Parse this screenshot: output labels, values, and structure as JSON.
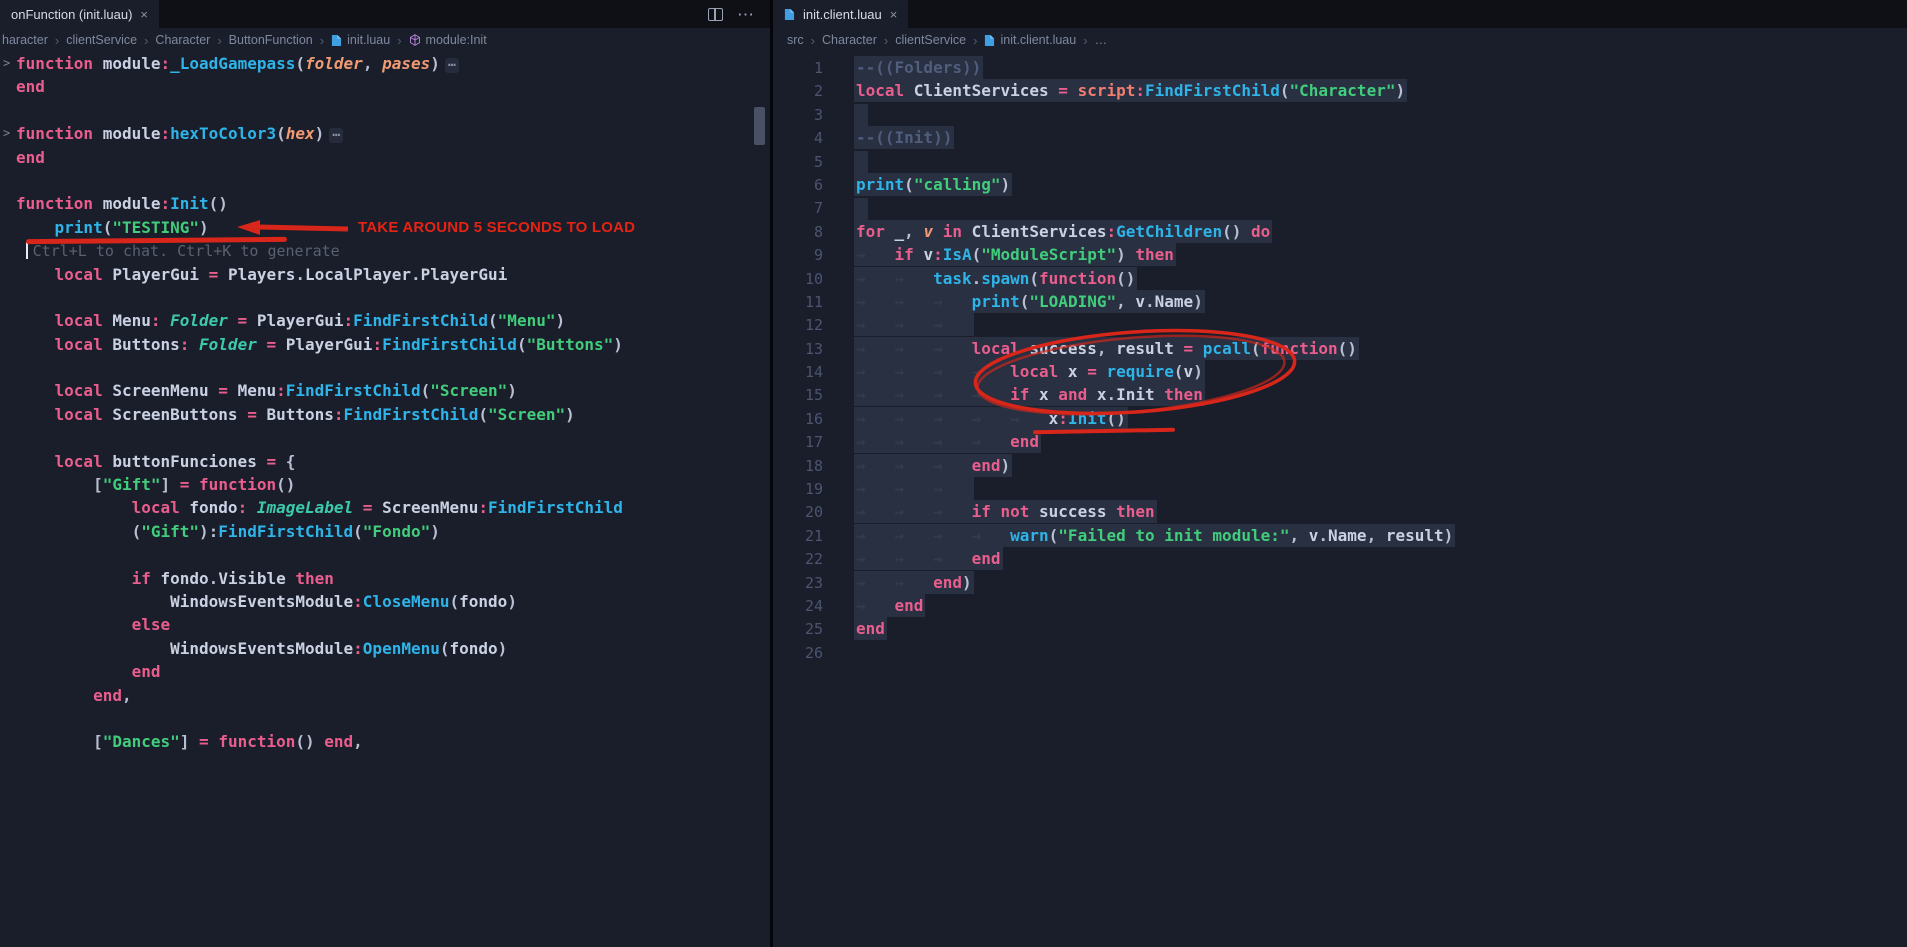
{
  "icons": {
    "close": "×",
    "more": "⋯",
    "fold": ">",
    "crumb_sep": "›",
    "file": "file-icon",
    "module_symbol": "module-cube-icon",
    "split_editor": "split-editor-icon"
  },
  "colors": {
    "editor_bg": "#1a1e2a",
    "tabbar_bg": "#0e1016",
    "annotation_red": "#d8261a",
    "keyword_pink": "#ea5e8e",
    "function_cyan": "#2eb4e8",
    "string_green": "#41cd7b",
    "type_teal": "#3cc9ac",
    "param_orange": "#f09a74",
    "comment_gray": "#505d7d",
    "selection": "rgba(121,140,190,0.16)"
  },
  "left": {
    "tab": {
      "label": "onFunction (init.luau)"
    },
    "breadcrumb": [
      "haracter",
      "clientService",
      "Character",
      "ButtonFunction",
      "init.luau",
      "module:Init"
    ],
    "annotation": {
      "note": "TAKE AROUND 5 SECONDS TO LOAD"
    },
    "code_lines": [
      {
        "fold": 1,
        "t": [
          [
            "k",
            "function "
          ],
          "module",
          [
            "o",
            ":"
          ],
          [
            "f",
            "_LoadGamepass"
          ],
          [
            "pu",
            "("
          ],
          [
            "p",
            "folder"
          ],
          [
            "pu",
            ", "
          ],
          [
            "p",
            "pases"
          ],
          [
            "pu",
            ")"
          ],
          [
            "d",
            "⋯"
          ]
        ]
      },
      {
        "t": [
          [
            "k",
            "end"
          ]
        ]
      },
      {
        "t": []
      },
      {
        "fold": 1,
        "t": [
          [
            "k",
            "function "
          ],
          "module",
          [
            "o",
            ":"
          ],
          [
            "f",
            "hexToColor3"
          ],
          [
            "pu",
            "("
          ],
          [
            "p",
            "hex"
          ],
          [
            "pu",
            ")"
          ],
          [
            "d",
            "⋯"
          ]
        ]
      },
      {
        "t": [
          [
            "k",
            "end"
          ]
        ]
      },
      {
        "t": []
      },
      {
        "t": [
          [
            "k",
            "function "
          ],
          "module",
          [
            "o",
            ":"
          ],
          [
            "f",
            "Init"
          ],
          [
            "pu",
            "()"
          ]
        ]
      },
      {
        "t": [
          "    ",
          [
            "f",
            "print"
          ],
          [
            "pu",
            "("
          ],
          [
            "s",
            "\"TESTING\""
          ],
          [
            "pu",
            ")"
          ]
        ]
      },
      {
        "t": [
          " ",
          [
            "cur",
            ""
          ],
          [
            "g",
            "Ctrl+L to chat. Ctrl+K to generate"
          ]
        ]
      },
      {
        "t": [
          "    ",
          [
            "k",
            "local "
          ],
          "PlayerGui",
          [
            "o",
            " = "
          ],
          "Players",
          [
            "pu",
            "."
          ],
          "LocalPlayer",
          [
            "pu",
            "."
          ],
          "PlayerGui"
        ]
      },
      {
        "t": []
      },
      {
        "t": [
          "    ",
          [
            "k",
            "local "
          ],
          "Menu",
          [
            "o",
            ": "
          ],
          [
            "t",
            "Folder"
          ],
          [
            "o",
            " = "
          ],
          "PlayerGui",
          [
            "o",
            ":"
          ],
          [
            "f",
            "FindFirstChild"
          ],
          [
            "pu",
            "("
          ],
          [
            "s",
            "\"Menu\""
          ],
          [
            "pu",
            ")"
          ]
        ]
      },
      {
        "t": [
          "    ",
          [
            "k",
            "local "
          ],
          "Buttons",
          [
            "o",
            ": "
          ],
          [
            "t",
            "Folder"
          ],
          [
            "o",
            " = "
          ],
          "PlayerGui",
          [
            "o",
            ":"
          ],
          [
            "f",
            "FindFirstChild"
          ],
          [
            "pu",
            "("
          ],
          [
            "s",
            "\"Buttons\""
          ],
          [
            "pu",
            ")"
          ]
        ]
      },
      {
        "t": []
      },
      {
        "t": [
          "    ",
          [
            "k",
            "local "
          ],
          "ScreenMenu",
          [
            "o",
            " = "
          ],
          "Menu",
          [
            "o",
            ":"
          ],
          [
            "f",
            "FindFirstChild"
          ],
          [
            "pu",
            "("
          ],
          [
            "s",
            "\"Screen\""
          ],
          [
            "pu",
            ")"
          ]
        ]
      },
      {
        "t": [
          "    ",
          [
            "k",
            "local "
          ],
          "ScreenButtons",
          [
            "o",
            " = "
          ],
          "Buttons",
          [
            "o",
            ":"
          ],
          [
            "f",
            "FindFirstChild"
          ],
          [
            "pu",
            "("
          ],
          [
            "s",
            "\"Screen\""
          ],
          [
            "pu",
            ")"
          ]
        ]
      },
      {
        "t": []
      },
      {
        "t": [
          "    ",
          [
            "k",
            "local "
          ],
          "buttonFunciones",
          [
            "o",
            " = "
          ],
          [
            "pu",
            "{"
          ]
        ]
      },
      {
        "t": [
          "        ",
          [
            "pu",
            "["
          ],
          [
            "s",
            "\"Gift\""
          ],
          [
            "pu",
            "]"
          ],
          [
            "o",
            " = "
          ],
          [
            "k",
            "function"
          ],
          [
            "pu",
            "()"
          ]
        ]
      },
      {
        "t": [
          "            ",
          [
            "k",
            "local "
          ],
          "fondo",
          [
            "o",
            ": "
          ],
          [
            "t",
            "ImageLabel"
          ],
          [
            "o",
            " = "
          ],
          "ScreenMenu",
          [
            "o",
            ":"
          ],
          [
            "f",
            "FindFirstChild"
          ]
        ]
      },
      {
        "t": [
          "            ",
          [
            "pu",
            "("
          ],
          [
            "s",
            "\"Gift\""
          ],
          [
            "pu",
            "):"
          ],
          [
            "f",
            "FindFirstChild"
          ],
          [
            "pu",
            "("
          ],
          [
            "s",
            "\"Fondo\""
          ],
          [
            "pu",
            ")"
          ]
        ]
      },
      {
        "t": []
      },
      {
        "t": [
          "            ",
          [
            "k",
            "if "
          ],
          "fondo",
          [
            "pu",
            "."
          ],
          "Visible",
          [
            "k",
            " then"
          ]
        ]
      },
      {
        "t": [
          "                ",
          "WindowsEventsModule",
          [
            "o",
            ":"
          ],
          [
            "f",
            "CloseMenu"
          ],
          [
            "pu",
            "("
          ],
          "fondo",
          [
            "pu",
            ")"
          ]
        ]
      },
      {
        "t": [
          "            ",
          [
            "k",
            "else"
          ]
        ]
      },
      {
        "t": [
          "                ",
          "WindowsEventsModule",
          [
            "o",
            ":"
          ],
          [
            "f",
            "OpenMenu"
          ],
          [
            "pu",
            "("
          ],
          "fondo",
          [
            "pu",
            ")"
          ]
        ]
      },
      {
        "t": [
          "            ",
          [
            "k",
            "end"
          ]
        ]
      },
      {
        "t": [
          "        ",
          [
            "k",
            "end"
          ],
          [
            "pu",
            ","
          ]
        ]
      },
      {
        "t": []
      },
      {
        "t": [
          "        ",
          [
            "pu",
            "["
          ],
          [
            "s",
            "\"Dances\""
          ],
          [
            "pu",
            "]"
          ],
          [
            "o",
            " = "
          ],
          [
            "k",
            "function"
          ],
          [
            "pu",
            "()"
          ],
          [
            "k",
            " end"
          ],
          [
            "pu",
            ","
          ]
        ]
      }
    ]
  },
  "right": {
    "tab": {
      "label": "init.client.luau"
    },
    "breadcrumb": [
      "src",
      "Character",
      "clientService",
      "init.client.luau",
      "…"
    ],
    "code_lines": [
      {
        "n": 1,
        "sel": 1,
        "t": [
          [
            "c",
            "--((Folders))"
          ]
        ]
      },
      {
        "n": 2,
        "sel": 1,
        "t": [
          [
            "k",
            "local "
          ],
          "ClientServices",
          [
            "o",
            " = "
          ],
          [
            "b",
            "script"
          ],
          [
            "o",
            ":"
          ],
          [
            "f",
            "FindFirstChild"
          ],
          [
            "pu",
            "("
          ],
          [
            "s",
            "\"Character\""
          ],
          [
            "pu",
            ")"
          ]
        ]
      },
      {
        "n": 3,
        "sel": 1,
        "t": []
      },
      {
        "n": 4,
        "sel": 1,
        "t": [
          [
            "c",
            "--((Init))"
          ]
        ]
      },
      {
        "n": 5,
        "sel": 1,
        "t": []
      },
      {
        "n": 6,
        "sel": 1,
        "t": [
          [
            "f",
            "print"
          ],
          [
            "pu",
            "("
          ],
          [
            "s",
            "\"calling\""
          ],
          [
            "pu",
            ")"
          ]
        ]
      },
      {
        "n": 7,
        "sel": 1,
        "t": []
      },
      {
        "n": 8,
        "sel": 1,
        "t": [
          [
            "k",
            "for "
          ],
          "_",
          [
            "pu",
            ", "
          ],
          [
            "p",
            "v"
          ],
          [
            "k",
            " in "
          ],
          "ClientServices",
          [
            "o",
            ":"
          ],
          [
            "f",
            "GetChildren"
          ],
          [
            "pu",
            "()"
          ],
          [
            "k",
            " do"
          ]
        ]
      },
      {
        "n": 9,
        "sel": 1,
        "t": [
          [
            "w",
            "→   "
          ],
          [
            "k",
            "if "
          ],
          "v",
          [
            "o",
            ":"
          ],
          [
            "f",
            "IsA"
          ],
          [
            "pu",
            "("
          ],
          [
            "s",
            "\"ModuleScript\""
          ],
          [
            "pu",
            ")"
          ],
          [
            "k",
            " then"
          ]
        ]
      },
      {
        "n": 10,
        "sel": 1,
        "t": [
          [
            "w",
            "→   →   "
          ],
          [
            "f",
            "task"
          ],
          [
            "pu",
            "."
          ],
          [
            "f",
            "spawn"
          ],
          [
            "pu",
            "("
          ],
          [
            "k",
            "function"
          ],
          [
            "pu",
            "()"
          ]
        ]
      },
      {
        "n": 11,
        "sel": 1,
        "t": [
          [
            "w",
            "→   →   →   "
          ],
          [
            "f",
            "print"
          ],
          [
            "pu",
            "("
          ],
          [
            "s",
            "\"LOADING\""
          ],
          [
            "pu",
            ", "
          ],
          "v",
          [
            "pu",
            "."
          ],
          "Name",
          [
            "pu",
            ")"
          ]
        ]
      },
      {
        "n": 12,
        "sel": 1,
        "t": [
          [
            "w",
            "→   →   →   "
          ]
        ]
      },
      {
        "n": 13,
        "sel": 1,
        "t": [
          [
            "w",
            "→   →   →   "
          ],
          [
            "k",
            "local "
          ],
          "success",
          [
            "pu",
            ", "
          ],
          "result",
          [
            "o",
            " = "
          ],
          [
            "f",
            "pcall"
          ],
          [
            "pu",
            "("
          ],
          [
            "k",
            "function"
          ],
          [
            "pu",
            "()"
          ]
        ]
      },
      {
        "n": 14,
        "sel": 1,
        "t": [
          [
            "w",
            "→   →   →   →   "
          ],
          [
            "k",
            "local "
          ],
          "x",
          [
            "o",
            " = "
          ],
          [
            "f",
            "require"
          ],
          [
            "pu",
            "("
          ],
          "v",
          [
            "pu",
            ")"
          ]
        ]
      },
      {
        "n": 15,
        "sel": 1,
        "t": [
          [
            "w",
            "→   →   →   →   "
          ],
          [
            "k",
            "if "
          ],
          "x",
          [
            "k",
            " and "
          ],
          "x",
          [
            "pu",
            "."
          ],
          "Init",
          [
            "k",
            " then"
          ]
        ]
      },
      {
        "n": 16,
        "sel": 1,
        "t": [
          [
            "w",
            "→   →   →   →   →   "
          ],
          "x",
          [
            "o",
            ":"
          ],
          [
            "f",
            "Init"
          ],
          [
            "pu",
            "()"
          ]
        ]
      },
      {
        "n": 17,
        "sel": 1,
        "t": [
          [
            "w",
            "→   →   →   →   "
          ],
          [
            "k",
            "end"
          ]
        ]
      },
      {
        "n": 18,
        "sel": 1,
        "t": [
          [
            "w",
            "→   →   →   "
          ],
          [
            "k",
            "end"
          ],
          [
            "pu",
            ")"
          ]
        ]
      },
      {
        "n": 19,
        "sel": 1,
        "t": [
          [
            "w",
            "→   →   →   "
          ]
        ]
      },
      {
        "n": 20,
        "sel": 1,
        "t": [
          [
            "w",
            "→   →   →   "
          ],
          [
            "k",
            "if not "
          ],
          "success",
          [
            "k",
            " then"
          ]
        ]
      },
      {
        "n": 21,
        "sel": 1,
        "t": [
          [
            "w",
            "→   →   →   →   "
          ],
          [
            "f",
            "warn"
          ],
          [
            "pu",
            "("
          ],
          [
            "s",
            "\"Failed to init module:\""
          ],
          [
            "pu",
            ", "
          ],
          "v",
          [
            "pu",
            "."
          ],
          "Name",
          [
            "pu",
            ", "
          ],
          "result",
          [
            "pu",
            ")"
          ]
        ]
      },
      {
        "n": 22,
        "sel": 1,
        "t": [
          [
            "w",
            "→   →   →   "
          ],
          [
            "k",
            "end"
          ]
        ]
      },
      {
        "n": 23,
        "sel": 1,
        "t": [
          [
            "w",
            "→   →   "
          ],
          [
            "k",
            "end"
          ],
          [
            "pu",
            ")"
          ]
        ]
      },
      {
        "n": 24,
        "sel": 1,
        "t": [
          [
            "w",
            "→   "
          ],
          [
            "k",
            "end"
          ]
        ]
      },
      {
        "n": 25,
        "sel": 1,
        "t": [
          [
            "k",
            "end"
          ]
        ]
      },
      {
        "n": 26,
        "t": []
      }
    ]
  }
}
